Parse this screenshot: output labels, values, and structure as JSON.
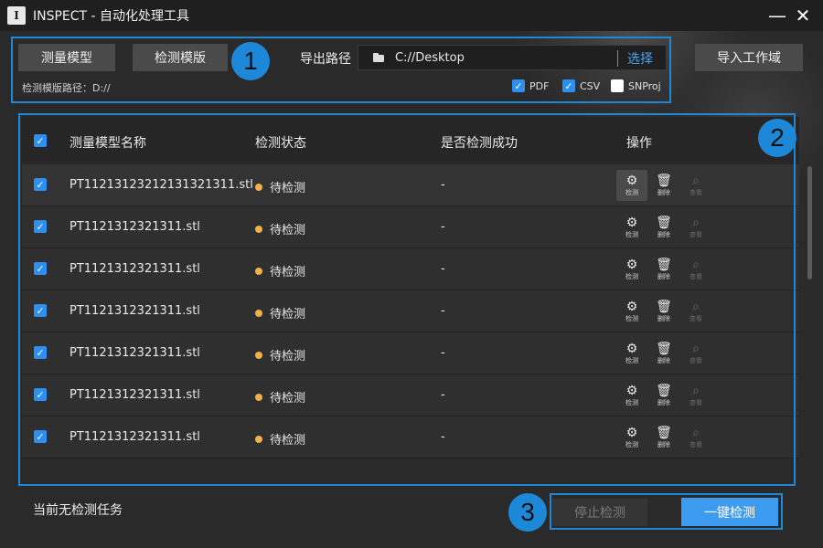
{
  "window": {
    "title": "INSPECT - 自动化处理工具",
    "logo_text": "I",
    "minimize_glyph": "—",
    "close_glyph": "✕"
  },
  "toolbar": {
    "measure_model_label": "测量模型",
    "inspect_template_label": "检测模版",
    "export_path_label": "导出路径",
    "export_path_value": "C://Desktop",
    "choose_label": "选择",
    "import_workspace_label": "导入工作域",
    "template_path_text": "检测模版路径：D://",
    "formats": [
      {
        "label": "PDF",
        "checked": true
      },
      {
        "label": "CSV",
        "checked": true
      },
      {
        "label": "SNProj",
        "checked": false
      }
    ]
  },
  "badges": [
    "1",
    "2",
    "3"
  ],
  "table": {
    "headers": [
      "测量模型名称",
      "检测状态",
      "是否检测成功",
      "操作"
    ],
    "select_all_checked": true,
    "actions": [
      {
        "label": "检测",
        "icon": "detect-gear-icon"
      },
      {
        "label": "删除",
        "icon": "trash-icon"
      },
      {
        "label": "查看",
        "icon": "magnifier-icon"
      }
    ],
    "rows": [
      {
        "name": "PT11213123212131321311.stl",
        "status": "待检测",
        "success": "-",
        "checked": true
      },
      {
        "name": "PT1121312321311.stl",
        "status": "待检测",
        "success": "-",
        "checked": true
      },
      {
        "name": "PT1121312321311.stl",
        "status": "待检测",
        "success": "-",
        "checked": true
      },
      {
        "name": "PT1121312321311.stl",
        "status": "待检测",
        "success": "-",
        "checked": true
      },
      {
        "name": "PT1121312321311.stl",
        "status": "待检测",
        "success": "-",
        "checked": true
      },
      {
        "name": "PT1121312321311.stl",
        "status": "待检测",
        "success": "-",
        "checked": true
      },
      {
        "name": "PT1121312321311.stl",
        "status": "待检测",
        "success": "-",
        "checked": true
      }
    ]
  },
  "footer": {
    "status_text": "当前无检测任务",
    "stop_label": "停止检测",
    "run_all_label": "一键检测"
  },
  "colors": {
    "accent": "#1e88d8",
    "primary_button": "#3d9cf0",
    "pending_dot": "#f2b04a"
  }
}
